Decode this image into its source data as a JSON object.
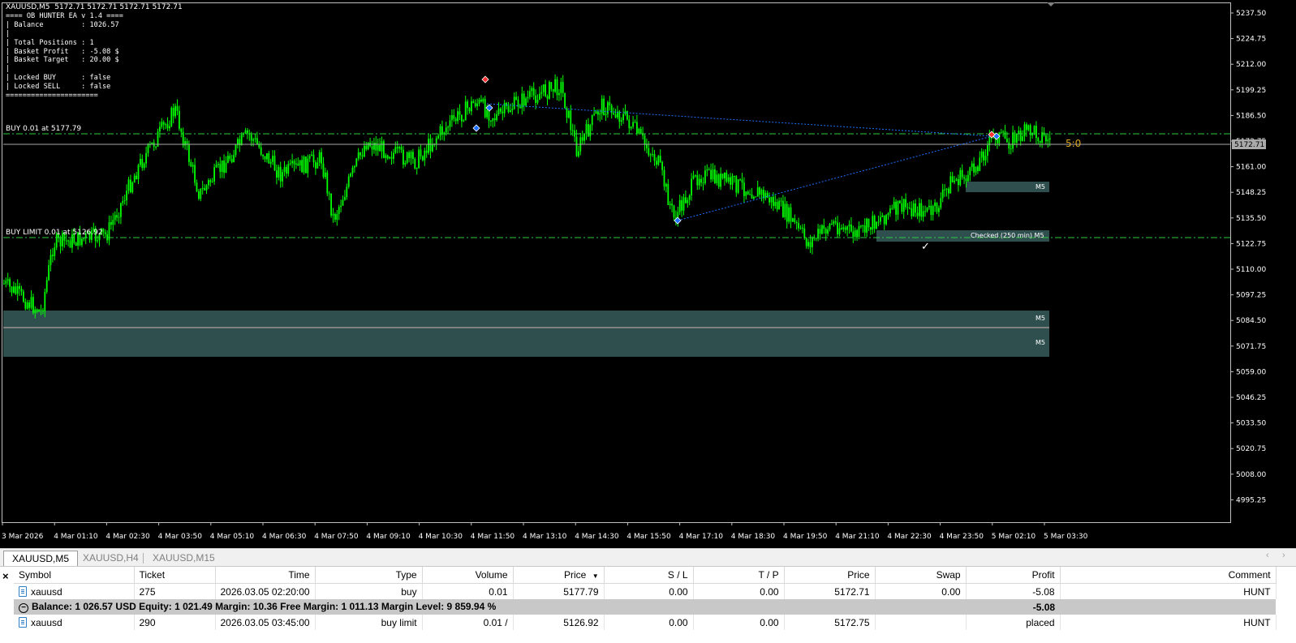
{
  "chart": {
    "header": "XAUUSD,M5  5172.71 5172.71 5172.71 5172.71",
    "info_lines": [
      "==== OB HUNTER EA v 1.4 ====",
      "| Balance         : 1026.57",
      "|",
      "| Total Positions : 1",
      "| Basket Profit   : -5.08 $",
      "| Basket Target   : 20.00 $",
      "|",
      "| Locked BUY      : false",
      "| Locked SELL     : false",
      "======================"
    ],
    "buy_line_label": "BUY 0.01 at 5177.79",
    "buy_limit_label": "BUY LIMIT 0.01 at 5126.92",
    "score_label": "5:0",
    "current_price": "5172.71",
    "price_axis": [
      "5237.50",
      "5224.75",
      "5212.00",
      "5199.25",
      "5186.50",
      "5173.75",
      "5161.00",
      "5148.25",
      "5135.50",
      "5122.75",
      "5110.00",
      "5097.25",
      "5084.50",
      "5071.75",
      "5059.00",
      "5046.25",
      "5033.50",
      "5020.75",
      "5008.00",
      "4995.25"
    ],
    "time_axis": [
      "3 Mar 2026",
      "4 Mar 01:10",
      "4 Mar 02:30",
      "4 Mar 03:50",
      "4 Mar 05:10",
      "4 Mar 06:30",
      "4 Mar 07:50",
      "4 Mar 09:10",
      "4 Mar 10:30",
      "4 Mar 11:50",
      "4 Mar 13:10",
      "4 Mar 14:30",
      "4 Mar 15:50",
      "4 Mar 17:10",
      "4 Mar 18:30",
      "4 Mar 19:50",
      "4 Mar 21:10",
      "4 Mar 22:30",
      "4 Mar 23:50",
      "5 Mar 02:10",
      "5 Mar 03:30"
    ],
    "zones": [
      {
        "label": "M5"
      },
      {
        "label": "Checked (250 min) M5"
      },
      {
        "label": "M5"
      },
      {
        "label": "M5"
      }
    ],
    "checkmark": "✓",
    "colors": {
      "bull": "#00ff00",
      "zone": "#2f4f4f",
      "buy_line": "#2ecc40",
      "dotted": "#1e6fff",
      "score": "#daa520"
    }
  },
  "tabs": [
    {
      "label": "XAUUSD,M5",
      "active": true
    },
    {
      "label": "XAUUSD,H4",
      "active": false
    },
    {
      "label": "XAUUSD,M15",
      "active": false
    }
  ],
  "terminal": {
    "close_icon": "×",
    "columns": [
      "Symbol",
      "Ticket",
      "Time",
      "Type",
      "Volume",
      "Price",
      "S / L",
      "T / P",
      "Price",
      "Swap",
      "Profit",
      "Comment"
    ],
    "sort_indicator": "▼",
    "rows": [
      [
        "xauusd",
        "275",
        "2026.03.05 02:20:00",
        "buy",
        "0.01",
        "5177.79",
        "0.00",
        "0.00",
        "5172.71",
        "0.00",
        "-5.08",
        "HUNT"
      ]
    ],
    "summary": {
      "text": "Balance: 1 026.57 USD  Equity: 1 021.49  Margin: 10.36  Free Margin: 1 011.13  Margin Level: 9 859.94 %",
      "profit": "-5.08"
    },
    "orders": [
      [
        "xauusd",
        "290",
        "2026.03.05 03:45:00",
        "buy limit",
        "0.01 /",
        "5126.92",
        "0.00",
        "0.00",
        "5172.75",
        "",
        "placed",
        "HUNT"
      ]
    ]
  }
}
